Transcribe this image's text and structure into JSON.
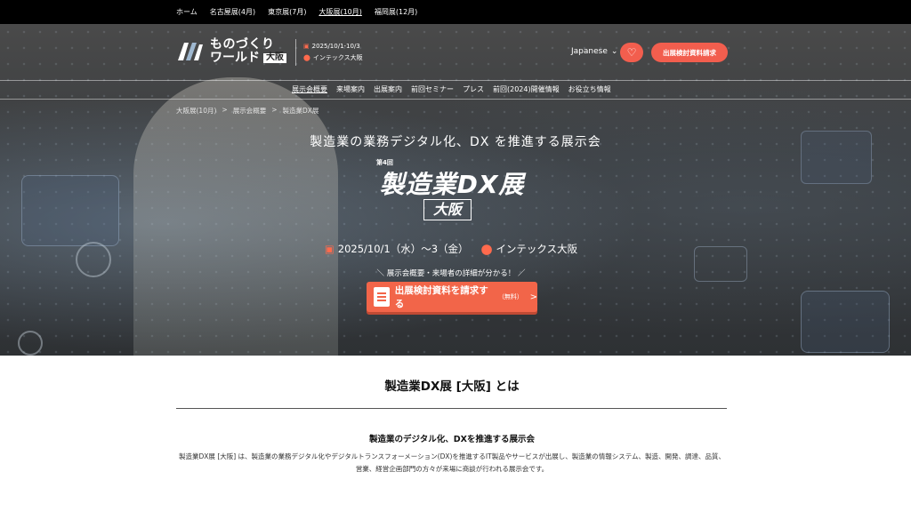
{
  "topnav": {
    "items": [
      "ホーム",
      "名古屋展(4月)",
      "東京展(7月)",
      "大阪展(10月)",
      "福岡展(12月)"
    ],
    "current_index": 3
  },
  "header": {
    "logo_line1": "ものづくり",
    "logo_line2": "ワールド",
    "logo_badge": "大阪",
    "dates": "2025/10/1-10/3",
    "venue": "インテックス大阪",
    "language": "Japanese",
    "cta_label": "出展検討資料請求"
  },
  "mainnav": {
    "items": [
      "展示会概要",
      "来場案内",
      "出展案内",
      "前回セミナー",
      "プレス",
      "前回(2024)開催情報",
      "お役立ち情報"
    ],
    "current_index": 0
  },
  "breadcrumb": [
    "大阪展(10月)",
    "展示会概要",
    "製造業DX展"
  ],
  "hero": {
    "subtitle": "製造業の業務デジタル化、DX を推進する展示会",
    "edition": "第4回",
    "title": "製造業DX展",
    "city": "大阪",
    "dates": "2025/10/1（水）～3（金）",
    "venue": "インテックス大阪",
    "note": "＼ 展示会概要・来場者の詳細が分かる！ ／",
    "cta_main": "出展検討資料を請求する",
    "cta_small": "（無料）",
    "cta_arrow": ">"
  },
  "about": {
    "title": "製造業DX展 [大阪] とは",
    "subtitle": "製造業のデジタル化、DXを推進する展示会",
    "body": "製造業DX展 [大阪] は、製造業の業務デジタル化やデジタルトランスフォーメーション(DX)を推進するIT製品やサービスが出展し、製造業の情報システム、製造、開発、調達、品質、営業、経営企画部門の方々が来場に商談が行われる展示会です。"
  },
  "colors": {
    "accent": "#f25e4e",
    "topbar": "#000000"
  },
  "icons": {
    "calendar": "calendar-icon",
    "pin": "map-pin-icon",
    "heart": "heart-icon",
    "chevron": "chevron-down-icon",
    "document": "document-icon"
  }
}
